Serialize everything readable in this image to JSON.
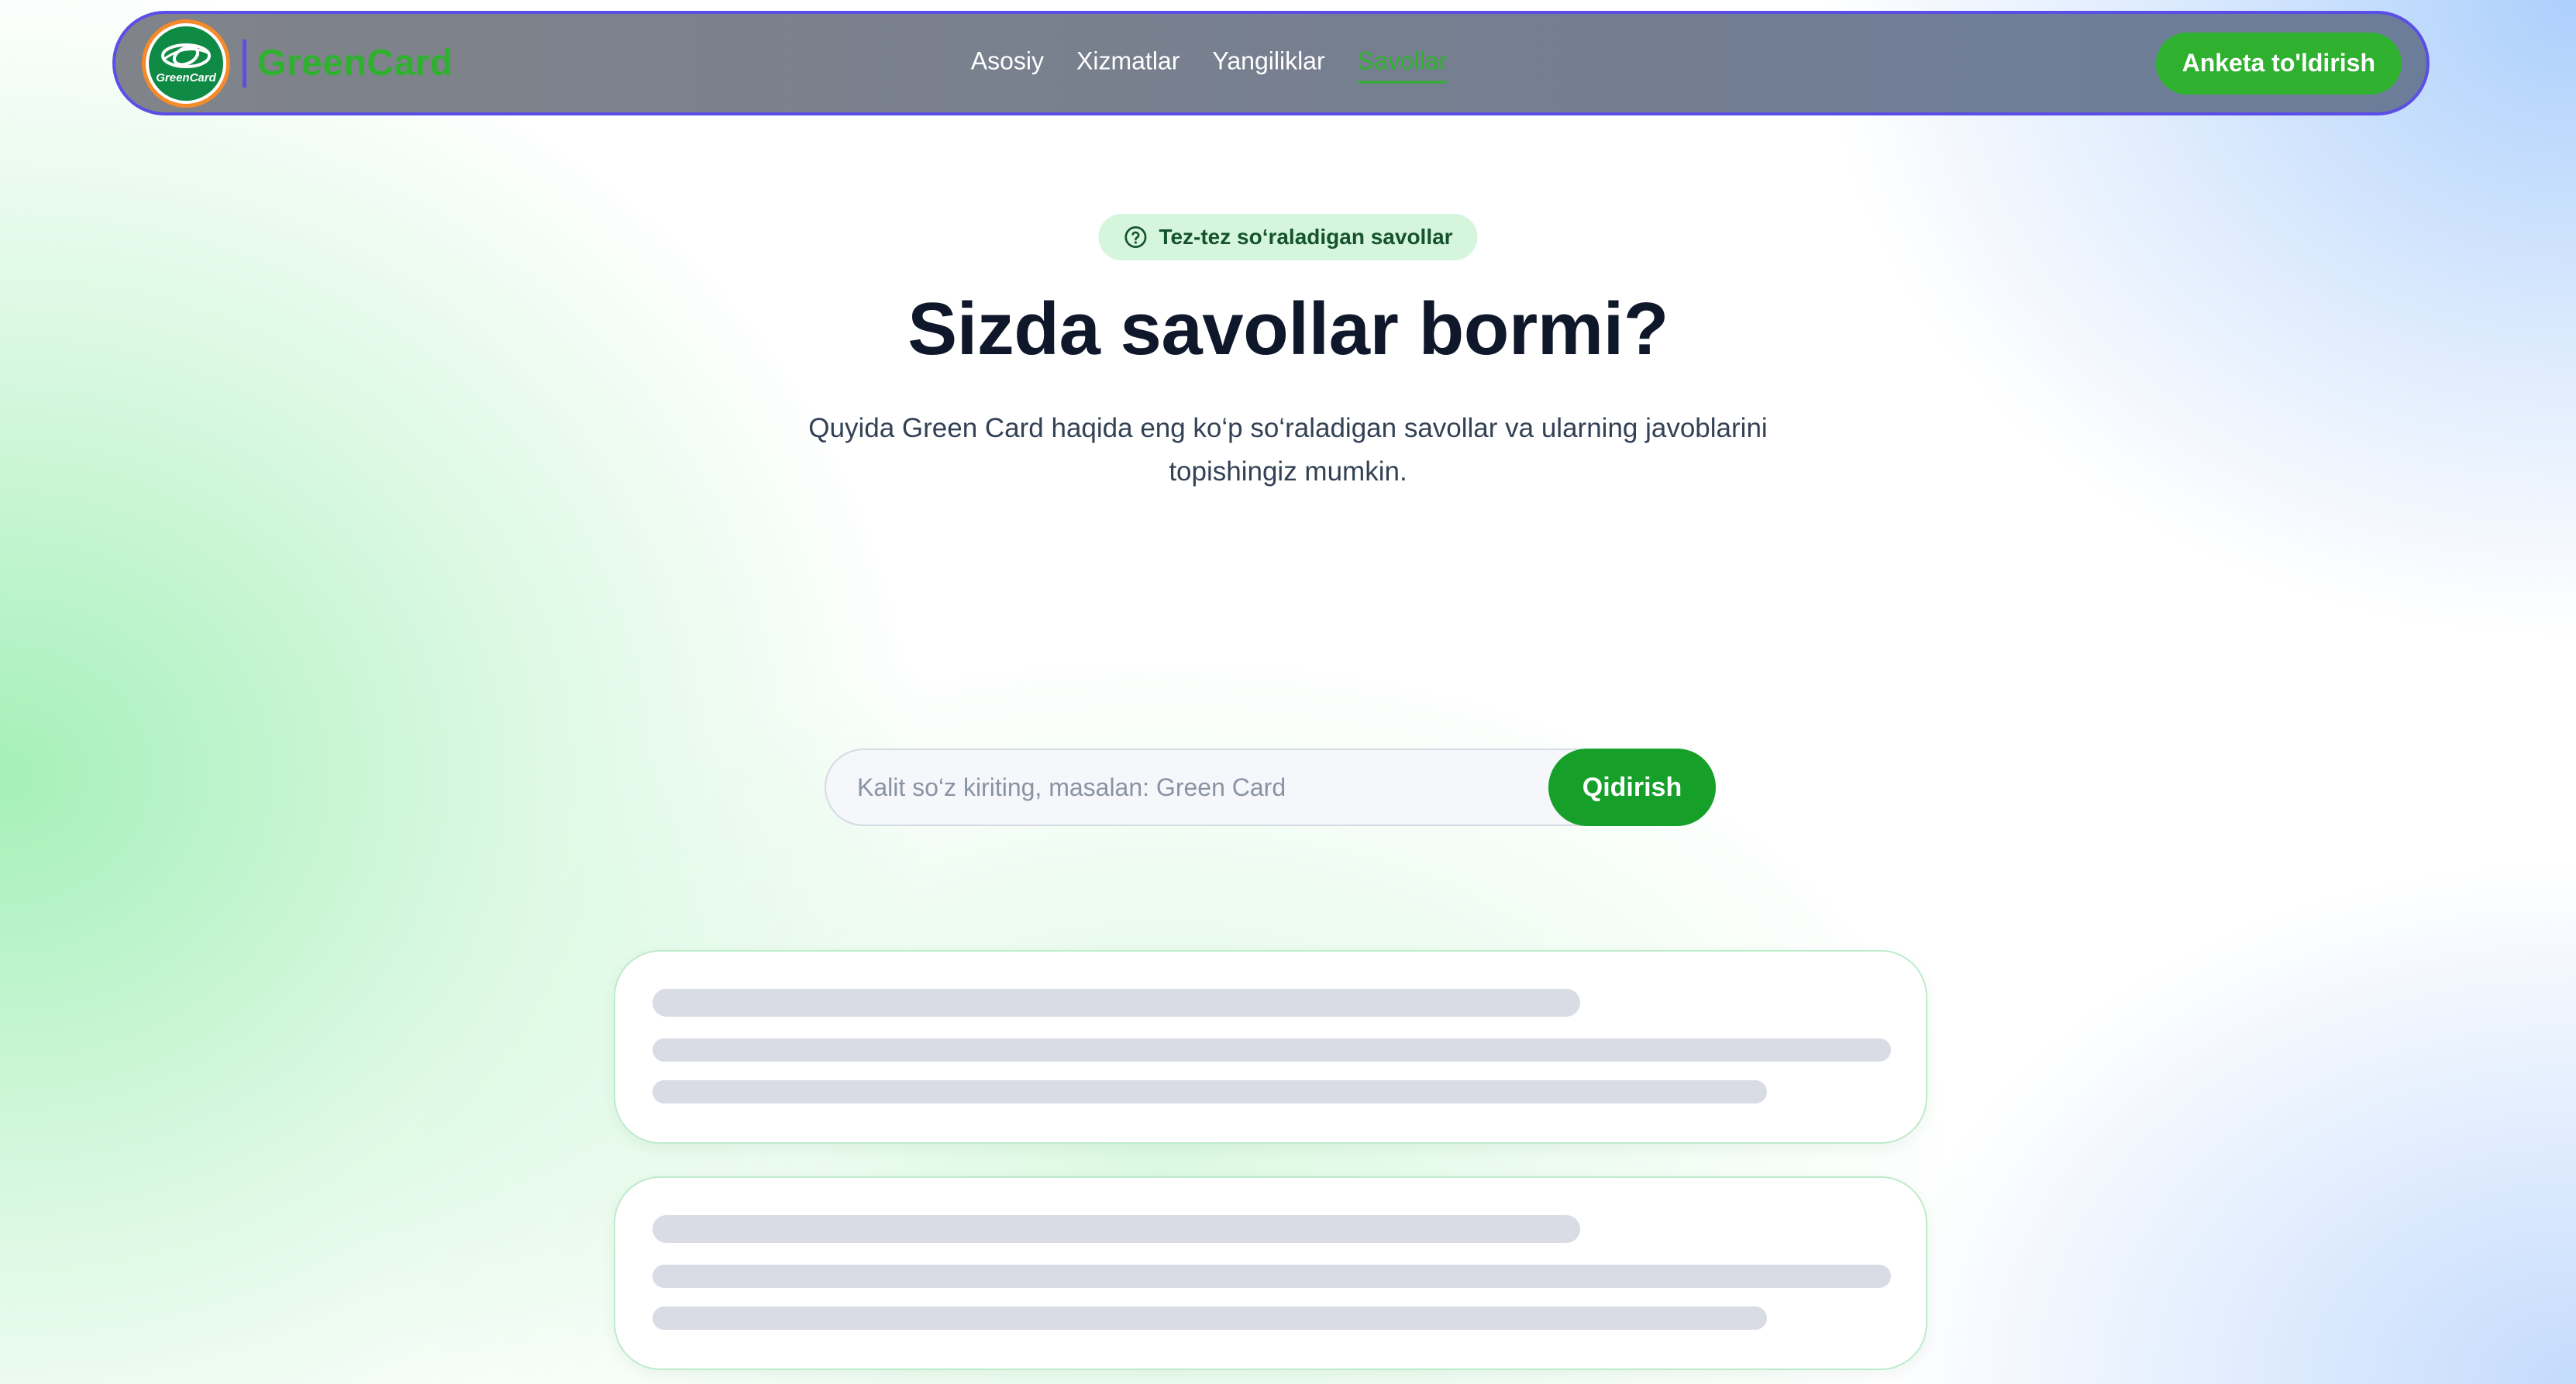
{
  "brand": {
    "name": "GreenCard",
    "badge_text": "GreenCard"
  },
  "nav": {
    "items": [
      {
        "label": "Asosiy",
        "active": false
      },
      {
        "label": "Xizmatlar",
        "active": false
      },
      {
        "label": "Yangiliklar",
        "active": false
      },
      {
        "label": "Savollar",
        "active": true
      }
    ],
    "cta_label": "Anketa to'ldirish"
  },
  "hero": {
    "badge_icon": "question-circle-icon",
    "badge_label": "Tez-tez so‘raladigan savollar",
    "title": "Sizda savollar bormi?",
    "subtitle": "Quyida Green Card haqida eng ko‘p so‘raladigan savollar va ularning javoblarini topishingiz mumkin."
  },
  "search": {
    "value": "",
    "placeholder": "Kalit so‘z kiriting, masalan: Green Card",
    "button_label": "Qidirish"
  },
  "faq": {
    "state": "loading",
    "skeleton_cards": 2
  },
  "colors": {
    "accent_green": "#2fb12f",
    "search_button_green": "#16a02a",
    "nav_border": "#5b4ee6",
    "badge_bg": "#d5f5dc",
    "title_text": "#0f172a",
    "skeleton": "#d9dce5"
  }
}
